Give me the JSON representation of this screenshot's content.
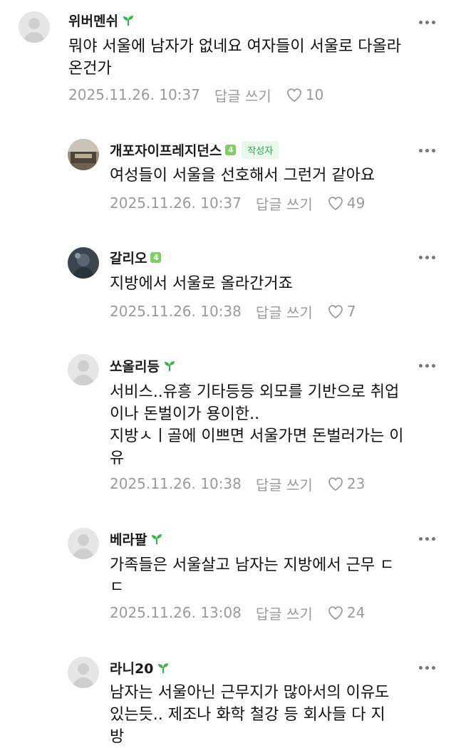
{
  "labels": {
    "reply": "답글 쓰기",
    "author": "작성자"
  },
  "comments": [
    {
      "nickname": "위버멘쉬",
      "level_badge": "",
      "lines": [
        "뭐야 서울에 남자가 없네요 여자들이 서울로 다올라",
        "온건가"
      ],
      "date": "2025.11.26. 10:37",
      "likes": "10"
    },
    {
      "nickname": "개포자이프레지던스",
      "level_badge": "4",
      "lines": [
        "여성들이 서울을 선호해서 그런거 같아요"
      ],
      "date": "2025.11.26. 10:37",
      "likes": "49"
    },
    {
      "nickname": "갈리오",
      "level_badge": "4",
      "lines": [
        "지방에서 서울로 올라간거죠"
      ],
      "date": "2025.11.26. 10:38",
      "likes": "7"
    },
    {
      "nickname": "쏘올리등",
      "level_badge": "",
      "lines": [
        "서비스..유흥 기타등등 외모를 기반으로 취업",
        "이나 돈벌이가 용이한..",
        "지방ㅅㅣ골에 이쁘면 서울가면 돈벌러가는 이",
        "유"
      ],
      "date": "2025.11.26. 10:38",
      "likes": "23"
    },
    {
      "nickname": "베라팔",
      "level_badge": "",
      "lines": [
        "가족들은 서울살고 남자는 지방에서 근무 ㄷ",
        "ㄷ"
      ],
      "date": "2025.11.26. 13:08",
      "likes": "24"
    },
    {
      "nickname": "라니20",
      "level_badge": "",
      "lines": [
        "남자는 서울아닌 근무지가 많아서의 이유도",
        "있는듯.. 제조나 화학 철강 등 회사들 다 지",
        "방"
      ]
    }
  ]
}
